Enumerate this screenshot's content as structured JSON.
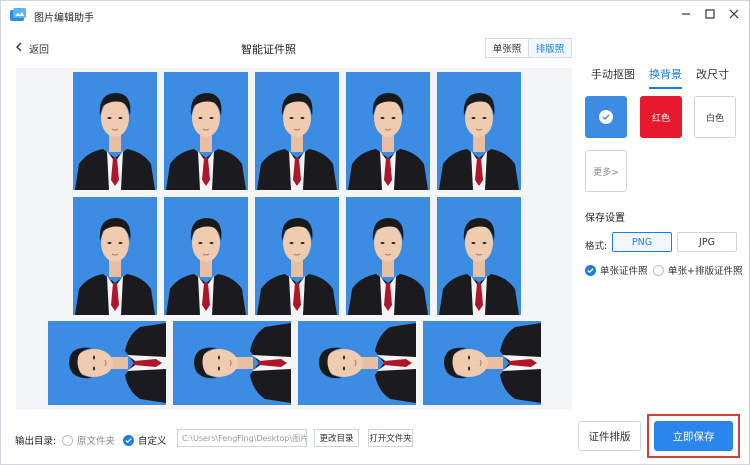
{
  "app": {
    "title": "图片编辑助手"
  },
  "header": {
    "back_label": "返回",
    "page_title": "智能证件照"
  },
  "mode_tabs": [
    {
      "label": "单张照",
      "active": false
    },
    {
      "label": "排版照",
      "active": true
    }
  ],
  "side_tabs": [
    {
      "label": "手动抠图",
      "active": false
    },
    {
      "label": "换背景",
      "active": true
    },
    {
      "label": "改尺寸",
      "active": false
    }
  ],
  "background_options": {
    "selected_color": "#3b8ce2",
    "red_label": "红色",
    "red_color": "#e8192c",
    "white_label": "白色",
    "more_label": "更多>"
  },
  "save_settings": {
    "title": "保存设置",
    "format_label": "格式:",
    "formats": [
      {
        "label": "PNG",
        "selected": true
      },
      {
        "label": "JPG",
        "selected": false
      }
    ],
    "modes": [
      {
        "label": "单张证件照",
        "checked": true
      },
      {
        "label": "单张+排版证件照",
        "checked": false
      }
    ]
  },
  "output": {
    "label": "输出目录:",
    "options": [
      {
        "label": "原文件夹",
        "checked": false
      },
      {
        "label": "自定义",
        "checked": true
      }
    ],
    "path_value": "C:\\Users\\FengFing\\Desktop\\图片\\",
    "change_dir_label": "更改目录",
    "open_folder_label": "打开文件夹"
  },
  "actions": {
    "layout_label": "证件排版",
    "save_label": "立即保存"
  },
  "canvas": {
    "photo_count": 14,
    "photo_background": "#3b8ce2"
  },
  "colors": {
    "accent": "#1e7fe0",
    "primary_button": "#2a86ec",
    "highlight_border": "#d6403a"
  }
}
